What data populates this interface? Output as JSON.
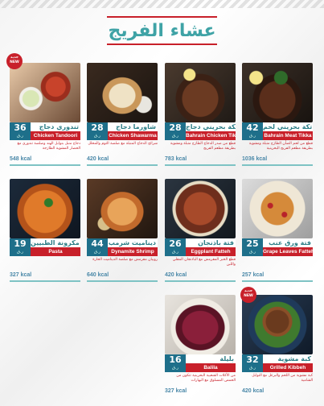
{
  "menu": {
    "title": "عشاء الفريج",
    "currency": "ر.ق",
    "badge": {
      "ar": "جديد",
      "en": "NEW"
    },
    "items": [
      {
        "name_ar": "تندوري دجاج",
        "name_en": "Chicken Tandoori",
        "price": "36",
        "kcal": "548 kcal",
        "desc": "دجاج متبل بتوابل الهند وصلصة تندوري مع الخضار المشوية الطازجة"
      },
      {
        "name_ar": "شاورما دجاج",
        "name_en": "Chicken Shawarma",
        "price": "28",
        "kcal": "420 kcal",
        "desc": "شرائح الدجاج المتبلة مع صلصة الثوم والمخلل"
      },
      {
        "name_ar": "تكة بحريني دجاج",
        "name_en": "Bahrain Chicken Tikka",
        "price": "28",
        "kcal": "783 kcal",
        "desc": "قطع من صدر الدجاج الطازج متبلة ومشوية بطريقة مطعم الفريج"
      },
      {
        "name_ar": "تكة بحريني لحم",
        "name_en": "Bahrain Meat Tikka",
        "price": "42",
        "kcal": "1036 kcal",
        "desc": "قطع من لحم الضأن الطازج متبلة ومشوية بطريقة مطعم الفريج البحرينية"
      },
      {
        "name_ar": "مكرونة الطبيين",
        "name_en": "Pasta",
        "price": "19",
        "kcal": "327 kcal",
        "desc": ""
      },
      {
        "name_ar": "ديناميت شرمب",
        "name_en": "Dynamite Shrimp",
        "price": "44",
        "kcal": "640 kcal",
        "desc": "روبيان مقرمش مع صلصة الديناميت الحارة"
      },
      {
        "name_ar": "فتة باذنجان",
        "name_en": "Eggplant Fatteh",
        "price": "26",
        "kcal": "420 kcal",
        "desc": "قطع الخبز المقرمش مع الباذنجان المقلي واللبن"
      },
      {
        "name_ar": "فتة ورق عنب",
        "name_en": "Grape Leaves Fatteh",
        "price": "25",
        "kcal": "257 kcal",
        "desc": ""
      },
      {
        "name_ar": "بليلة",
        "name_en": "Balila",
        "price": "16",
        "kcal": "327 kcal",
        "desc": "من الأكلات الشعبية البحرينية تتكون من الحمص المسلوق مع البهارات"
      },
      {
        "name_ar": "كبة مشوية",
        "name_en": "Grilled Kibbeh",
        "price": "32",
        "kcal": "420 kcal",
        "desc": "كبة مشوية من اللحم والبرغل مع التوابل الشامية"
      }
    ]
  }
}
